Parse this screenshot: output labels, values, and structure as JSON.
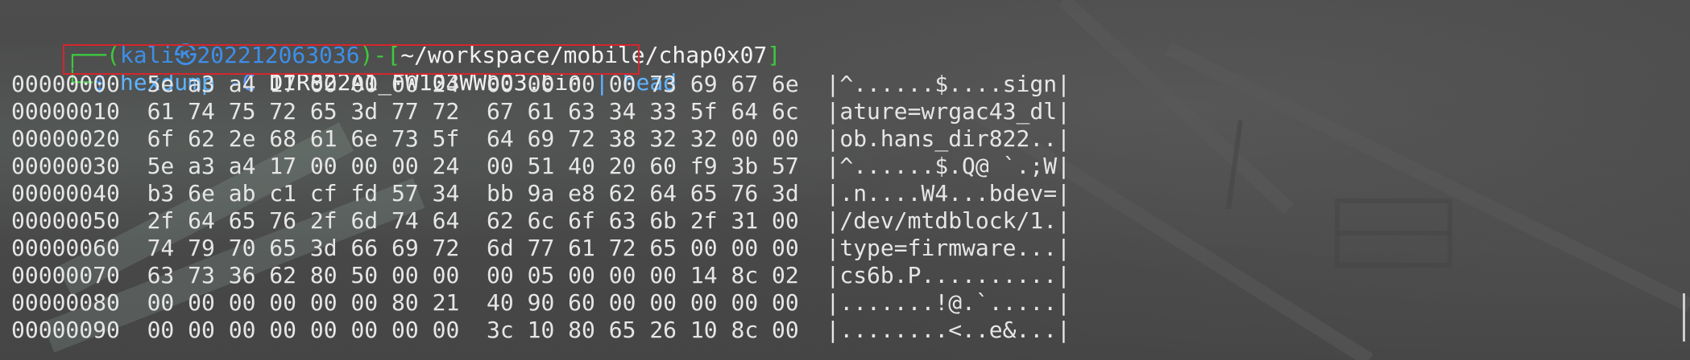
{
  "prompt": {
    "user": "kali",
    "skull": "㉿",
    "host": "202212063036",
    "path": "~/workspace/mobile/chap0x07",
    "symbol": "$"
  },
  "command": {
    "cmd": "hexdump",
    "flag": "-C",
    "arg": "DIR822A1_FW103WWb03.bin",
    "pipe": "|",
    "next": "head"
  },
  "rows": [
    {
      "offset": "00000000",
      "hex1": "5e a3 a4 17 00 00 00 24",
      "hex2": "00 00 00 00 73 69 67 6e",
      "ascii": "|^......$....sign|"
    },
    {
      "offset": "00000010",
      "hex1": "61 74 75 72 65 3d 77 72",
      "hex2": "67 61 63 34 33 5f 64 6c",
      "ascii": "|ature=wrgac43_dl|"
    },
    {
      "offset": "00000020",
      "hex1": "6f 62 2e 68 61 6e 73 5f",
      "hex2": "64 69 72 38 32 32 00 00",
      "ascii": "|ob.hans_dir822..|"
    },
    {
      "offset": "00000030",
      "hex1": "5e a3 a4 17 00 00 00 24",
      "hex2": "00 51 40 20 60 f9 3b 57",
      "ascii": "|^......$.Q@ `.;W|"
    },
    {
      "offset": "00000040",
      "hex1": "b3 6e ab c1 cf fd 57 34",
      "hex2": "bb 9a e8 62 64 65 76 3d",
      "ascii": "|.n....W4...bdev=|"
    },
    {
      "offset": "00000050",
      "hex1": "2f 64 65 76 2f 6d 74 64",
      "hex2": "62 6c 6f 63 6b 2f 31 00",
      "ascii": "|/dev/mtdblock/1.|"
    },
    {
      "offset": "00000060",
      "hex1": "74 79 70 65 3d 66 69 72",
      "hex2": "6d 77 61 72 65 00 00 00",
      "ascii": "|type=firmware...|"
    },
    {
      "offset": "00000070",
      "hex1": "63 73 36 62 80 50 00 00",
      "hex2": "00 05 00 00 00 14 8c 02",
      "ascii": "|cs6b.P..........|"
    },
    {
      "offset": "00000080",
      "hex1": "00 00 00 00 00 00 80 21",
      "hex2": "40 90 60 00 00 00 00 00",
      "ascii": "|.......!@.`.....|"
    },
    {
      "offset": "00000090",
      "hex1": "00 00 00 00 00 00 00 00",
      "hex2": "3c 10 80 65 26 10 8c 00",
      "ascii": "|........<..e&...|"
    }
  ],
  "colors": {
    "prompt_frame": "#3ec93e",
    "prompt_user": "#3d8fe8",
    "highlight_box": "#d5262d"
  }
}
